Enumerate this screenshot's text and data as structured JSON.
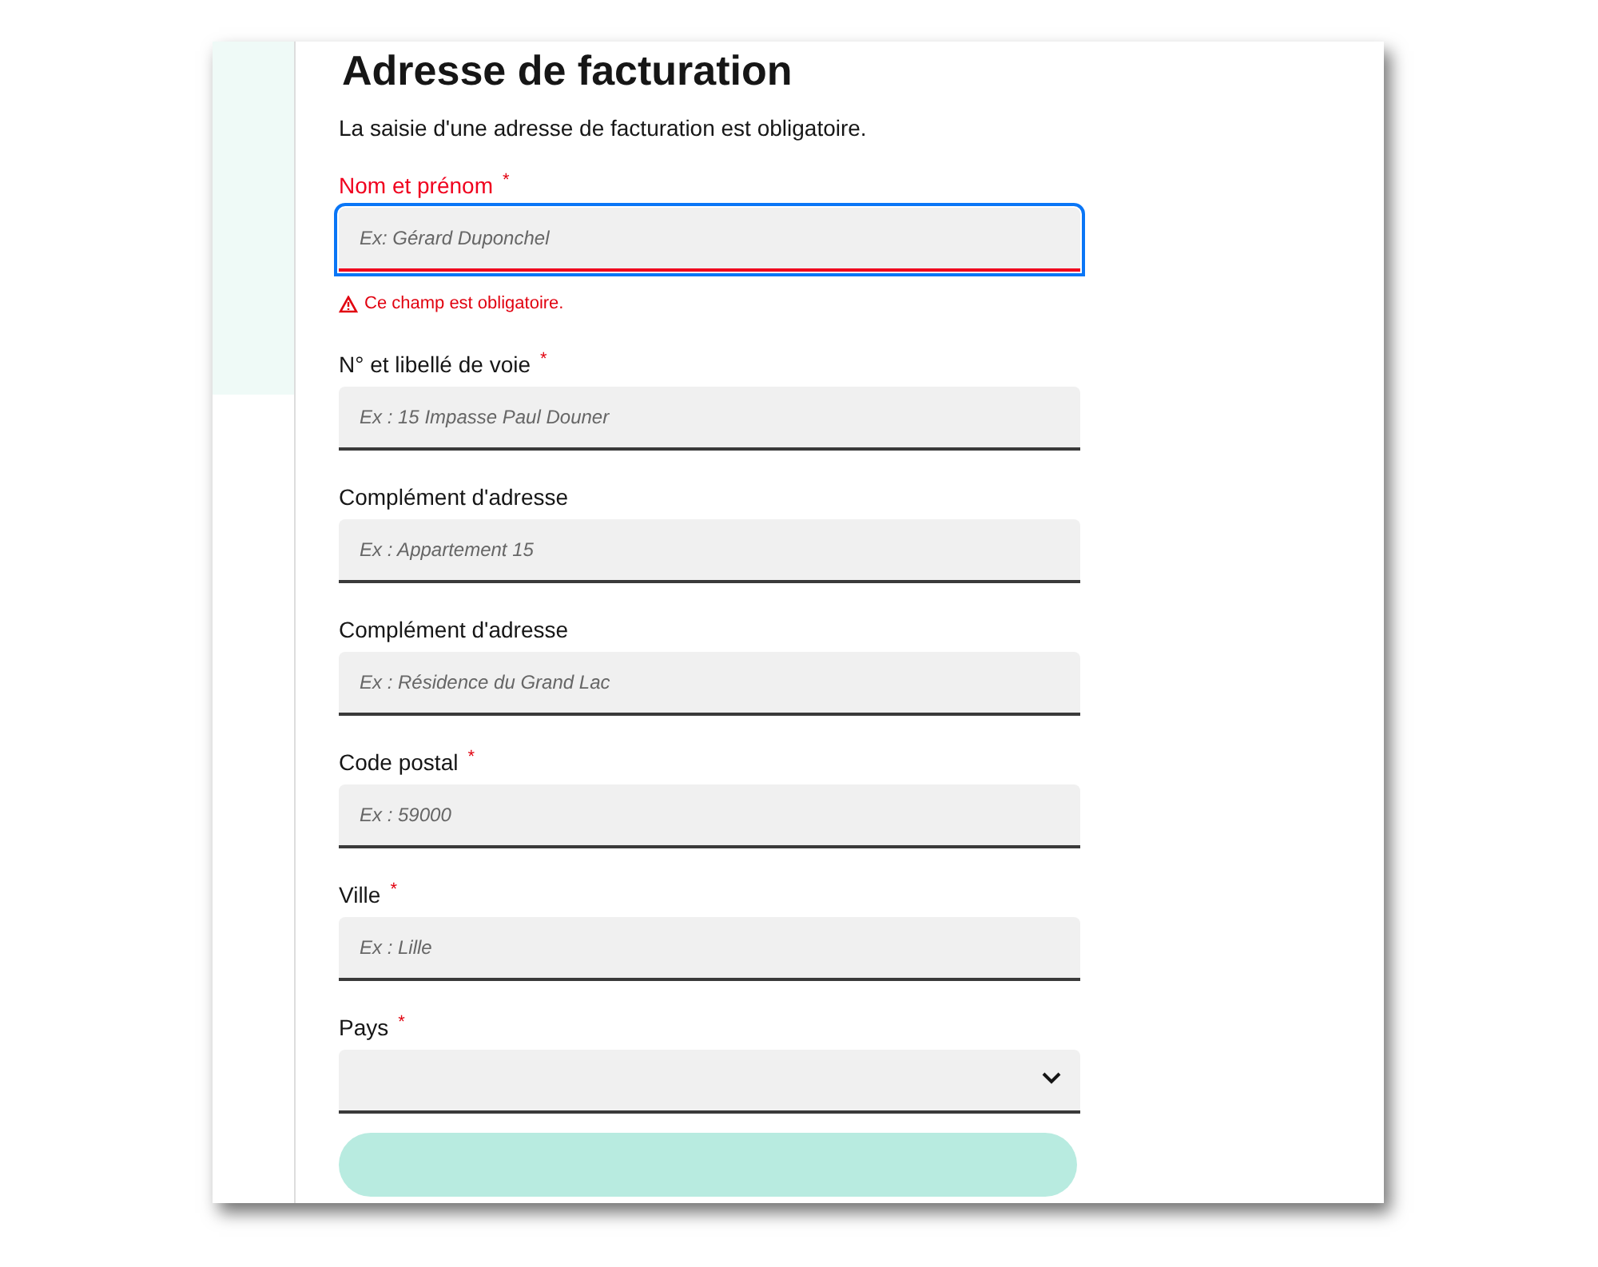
{
  "title": "Adresse de facturation",
  "intro": "La saisie d'une adresse de facturation est obligatoire.",
  "fields": [
    {
      "kind": "text",
      "label": "Nom et prénom",
      "required_mark": "*",
      "placeholder": "Ex: Gérard Duponchel",
      "focused": true,
      "invalid": true,
      "error": "Ce champ est obligatoire."
    },
    {
      "kind": "text",
      "label": "N° et libellé de voie",
      "required_mark": "*",
      "placeholder": "Ex : 15 Impasse Paul Douner",
      "focused": false,
      "invalid": false
    },
    {
      "kind": "text",
      "label": "Complément d'adresse",
      "placeholder": "Ex : Appartement 15",
      "focused": false,
      "invalid": false
    },
    {
      "kind": "text",
      "label": "Complément d'adresse",
      "placeholder": "Ex : Résidence du Grand Lac",
      "focused": false,
      "invalid": false
    },
    {
      "kind": "text",
      "label": "Code postal",
      "required_mark": "*",
      "placeholder": "Ex : 59000",
      "focused": false,
      "invalid": false
    },
    {
      "kind": "text",
      "label": "Ville",
      "required_mark": "*",
      "placeholder": "Ex : Lille",
      "focused": false,
      "invalid": false
    },
    {
      "kind": "select",
      "label": "Pays",
      "required_mark": "*",
      "focused": false,
      "invalid": false
    }
  ]
}
